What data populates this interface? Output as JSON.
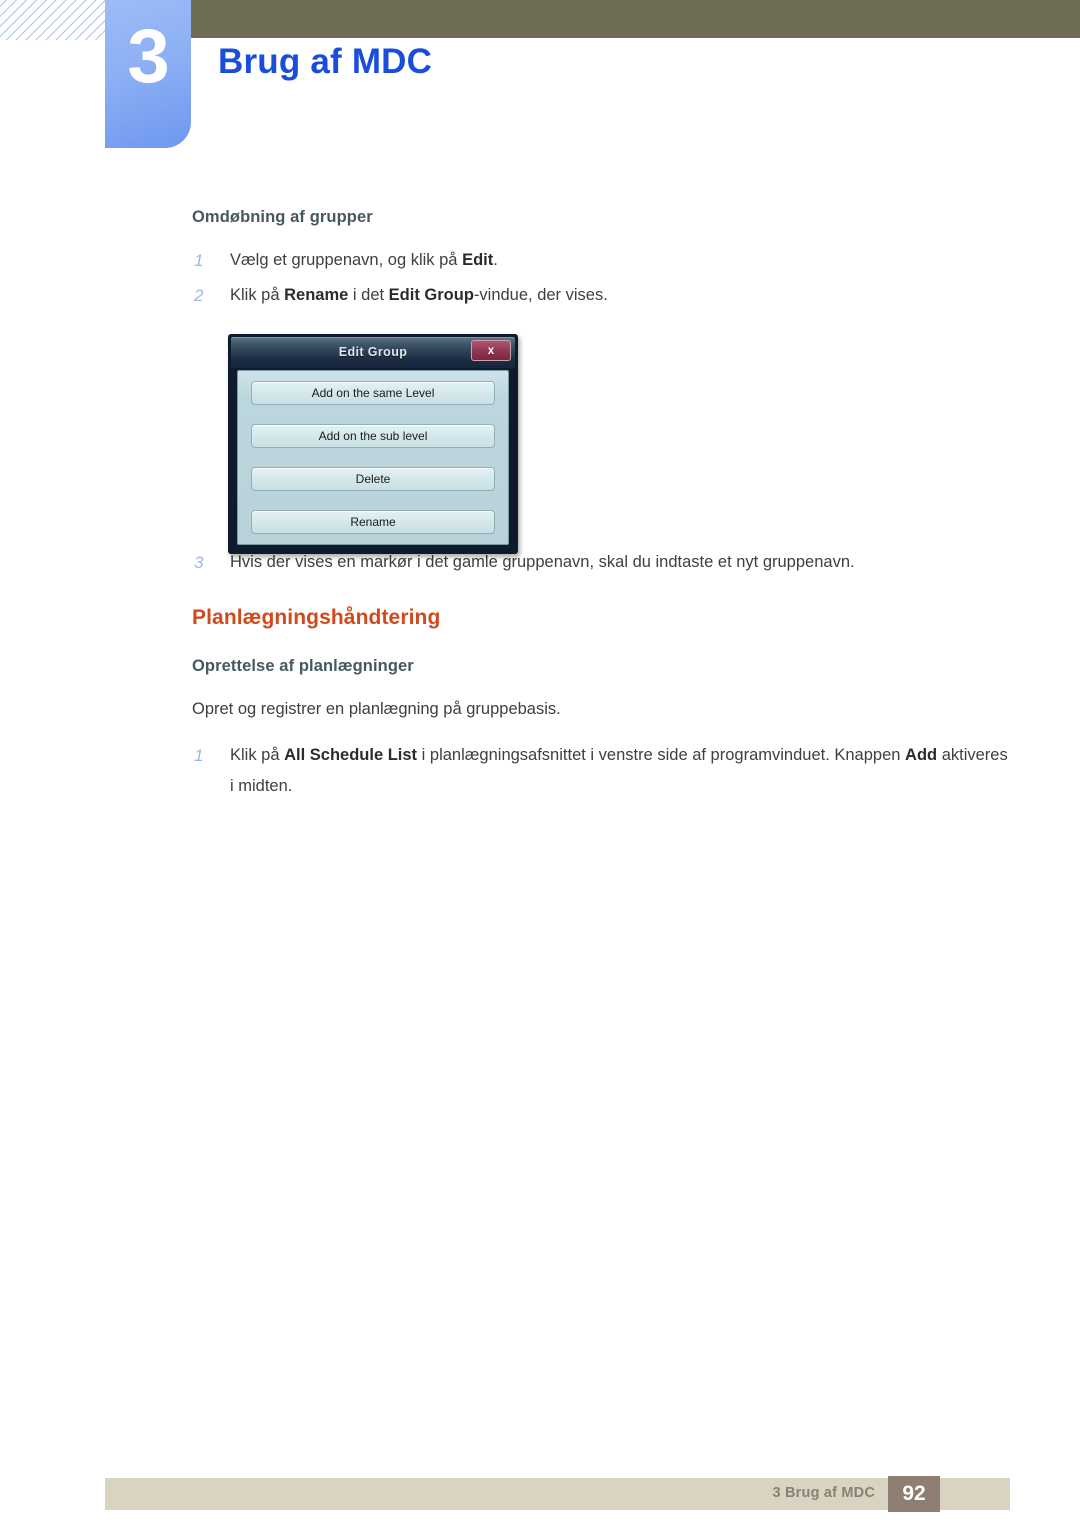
{
  "header": {
    "chapter_number": "3",
    "chapter_title": "Brug af MDC",
    "olive_bar_color": "#6e6c55",
    "badge_color": "#8cb0f4",
    "title_color": "#1a4ddb"
  },
  "content": {
    "subheading_1": "Omdøbning af grupper",
    "steps_1": [
      {
        "marker": "1",
        "pre": "Vælg et gruppenavn, og klik på ",
        "bold": "Edit",
        "post": "."
      },
      {
        "marker": "2",
        "pre": "Klik på ",
        "bold": "Rename",
        "mid": " i det ",
        "bold2": "Edit Group",
        "post": "-vindue, der vises."
      }
    ],
    "step_3": {
      "marker": "3",
      "text": "Hvis der vises en markør i det gamle gruppenavn, skal du indtaste et nyt gruppenavn."
    },
    "section_heading": "Planlægningshåndtering",
    "section_heading_color": "#d2491b",
    "subheading_2": "Oprettelse af planlægninger",
    "paragraph": "Opret og registrer en planlægning på gruppebasis.",
    "step_4": {
      "marker": "1",
      "pre": "Klik på ",
      "bold": "All Schedule List",
      "mid": " i planlægningsafsnittet i venstre side af programvinduet. Knappen ",
      "bold2": "Add",
      "post": " aktiveres i midten."
    }
  },
  "dialog": {
    "title": "Edit Group",
    "close_label": "x",
    "close_color": "#8e3550",
    "buttons": [
      "Add on the same Level",
      "Add on the sub level",
      "Delete",
      "Rename"
    ]
  },
  "footer": {
    "text": "3 Brug af MDC",
    "page_number": "92",
    "bar_color": "#d9d4c2",
    "page_box_color": "#8e7f72"
  }
}
